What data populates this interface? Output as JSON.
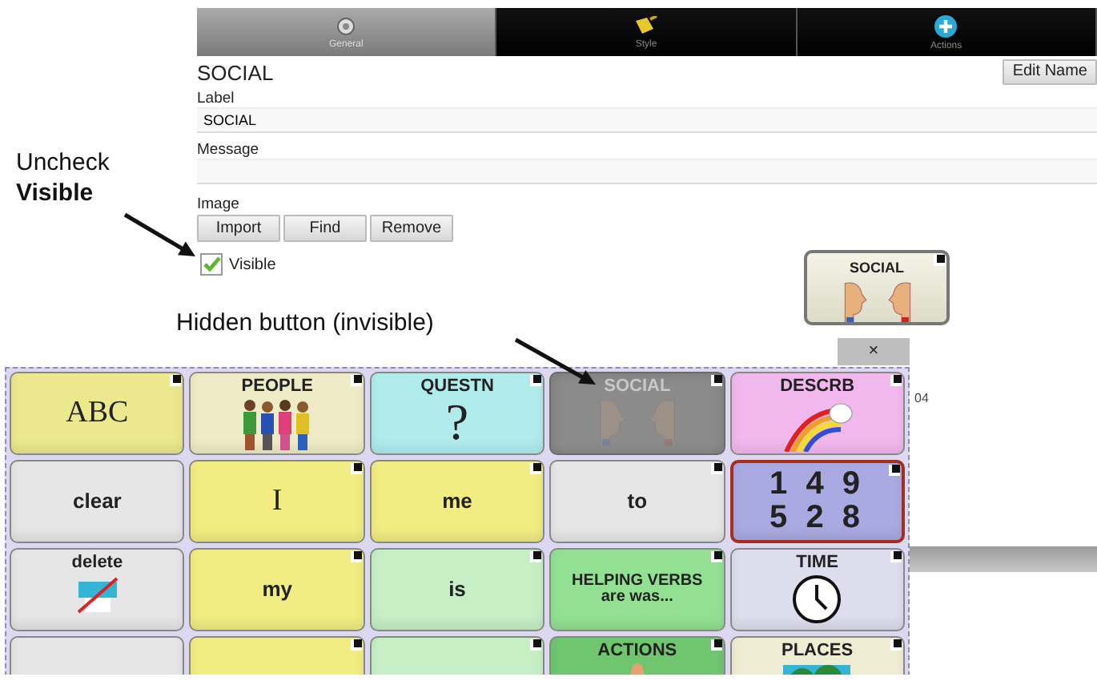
{
  "tabs": [
    {
      "label": "General",
      "selected": true
    },
    {
      "label": "Style",
      "selected": false
    },
    {
      "label": "Actions",
      "selected": false
    }
  ],
  "editor": {
    "title": "SOCIAL",
    "edit_button": "Edit Name",
    "label_caption": "Label",
    "label_value": "SOCIAL",
    "message_caption": "Message",
    "image_caption": "Image",
    "image_buttons": [
      "Import",
      "Find",
      "Remove"
    ],
    "visible": {
      "label": "Visible",
      "checked": true
    }
  },
  "preview": {
    "label": "SOCIAL",
    "close": "×"
  },
  "page_number": "04",
  "grid": {
    "rows": [
      {
        "cells": [
          {
            "kind": "letter",
            "lines": [
              "ABC"
            ],
            "color": "#ebe88e",
            "linked": true,
            "hidden": false,
            "highlighted": false
          },
          {
            "kind": "picture",
            "lines": [
              "PEOPLE"
            ],
            "color": "#efebc6",
            "linked": true,
            "hidden": false,
            "highlighted": false
          },
          {
            "kind": "symbol",
            "lines": [
              "QUESTN"
            ],
            "symbol": "?",
            "color": "#b0ecec",
            "linked": true,
            "hidden": false,
            "highlighted": false
          },
          {
            "kind": "picture",
            "lines": [
              "SOCIAL"
            ],
            "color": "#8b8b8b",
            "linked": true,
            "hidden": true,
            "highlighted": false
          },
          {
            "kind": "picture",
            "lines": [
              "DESCRB"
            ],
            "color": "#f2b8ee",
            "linked": true,
            "hidden": false,
            "highlighted": false
          }
        ]
      },
      {
        "cells": [
          {
            "kind": "word",
            "lines": [
              "clear"
            ],
            "color": "#e6e6e6",
            "linked": false,
            "hidden": false,
            "highlighted": false
          },
          {
            "kind": "letter",
            "lines": [
              "I"
            ],
            "color": "#f1ed82",
            "linked": true,
            "hidden": false,
            "highlighted": false
          },
          {
            "kind": "word",
            "lines": [
              "me"
            ],
            "color": "#f1ed82",
            "linked": true,
            "hidden": false,
            "highlighted": false
          },
          {
            "kind": "word",
            "lines": [
              "to"
            ],
            "color": "#e6e6e6",
            "linked": true,
            "hidden": false,
            "highlighted": false
          },
          {
            "kind": "numbers",
            "lines": [
              "1 4 9",
              "5 2 8"
            ],
            "color": "#aaaae2",
            "linked": true,
            "hidden": false,
            "highlighted": true
          }
        ]
      },
      {
        "cells": [
          {
            "kind": "picture",
            "lines": [
              "delete"
            ],
            "color": "#e6e6e6",
            "linked": false,
            "hidden": false,
            "highlighted": false
          },
          {
            "kind": "word",
            "lines": [
              "my"
            ],
            "color": "#f1ed82",
            "linked": true,
            "hidden": false,
            "highlighted": false
          },
          {
            "kind": "word",
            "lines": [
              "is"
            ],
            "color": "#c6efc6",
            "linked": true,
            "hidden": false,
            "highlighted": false
          },
          {
            "kind": "phrase",
            "lines": [
              "HELPING VERBS",
              "are was..."
            ],
            "color": "#92e192",
            "linked": true,
            "hidden": false,
            "highlighted": false
          },
          {
            "kind": "picture",
            "lines": [
              "TIME"
            ],
            "color": "#dedded",
            "linked": true,
            "hidden": false,
            "highlighted": false
          }
        ]
      },
      {
        "cells": [
          {
            "kind": "blank",
            "color": "#e6e6e6",
            "linked": false,
            "hidden": false,
            "highlighted": false
          },
          {
            "kind": "blank",
            "color": "#f1ed82",
            "linked": true,
            "hidden": false,
            "highlighted": false
          },
          {
            "kind": "blank",
            "color": "#c6efc6",
            "linked": true,
            "hidden": false,
            "highlighted": false
          },
          {
            "kind": "picture",
            "lines": [
              "ACTIONS"
            ],
            "color": "#6fc66f",
            "linked": true,
            "hidden": false,
            "highlighted": false
          },
          {
            "kind": "picture",
            "lines": [
              "PLACES"
            ],
            "color": "#eeecd2",
            "linked": true,
            "hidden": false,
            "highlighted": false
          }
        ]
      }
    ]
  },
  "annotations": [
    {
      "kind": "checkbox-note",
      "lines": [
        "Uncheck",
        "**Visible**"
      ]
    },
    {
      "kind": "hidden-note",
      "lines": [
        "Hidden button (invisible)"
      ]
    }
  ]
}
